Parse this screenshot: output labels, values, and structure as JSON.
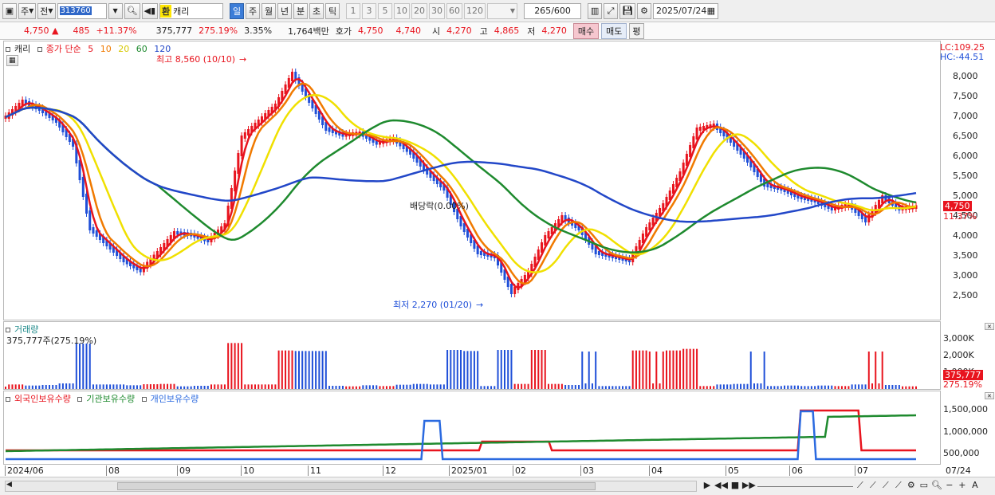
{
  "toolbar": {
    "type": "주",
    "market": "전",
    "code": "313760",
    "tag": "환",
    "name": "캐리",
    "periods": [
      "일",
      "주",
      "월",
      "년",
      "분",
      "초",
      "틱"
    ],
    "active_period": "일",
    "intervals": [
      "1",
      "3",
      "5",
      "10",
      "20",
      "30",
      "60",
      "120"
    ],
    "count": "265",
    "count_total": "/600",
    "date": "2025/07/24"
  },
  "quote": {
    "price": "4,750",
    "arrow": "▲",
    "change": "485",
    "change_pct": "+11.37%",
    "volume": "375,777",
    "volume_ratio": "275.19%",
    "turnover": "3.35%",
    "amount": "1,764백만",
    "ask_label": "호가",
    "ask1": "4,750",
    "ask2": "4,740",
    "open_label": "시",
    "open": "4,270",
    "high_label": "고",
    "high": "4,865",
    "low_label": "저",
    "low": "4,270",
    "buy": "매수",
    "sell": "매도",
    "eval": "평"
  },
  "price_panel": {
    "name": "캐리",
    "ma_label": "종가 단순",
    "ma_periods": [
      "5",
      "10",
      "20",
      "60",
      "120"
    ],
    "ma_colors": [
      "#e8141e",
      "#f07a00",
      "#f0e000",
      "#1e8a2e",
      "#2247c8"
    ],
    "lc": "LC:109.25",
    "hc": "HC:-44.51",
    "y_ticks": [
      "8,000",
      "7,500",
      "7,000",
      "6,500",
      "6,000",
      "5,500",
      "5,000",
      "4,500",
      "4,000",
      "3,500",
      "3,000",
      "2,500"
    ],
    "cur_price": "4,750",
    "cur_pct": "11.37%",
    "high_note": "최고 8,560 (10/10)",
    "low_note": "최저 2,270 (01/20)",
    "div_note": "배당락(0.00%)"
  },
  "volume_panel": {
    "title": "거래량",
    "value": "375,777주(275.19%)",
    "y_ticks": [
      "3,000K",
      "2,000K",
      "1,000K"
    ],
    "cur_vol": "375,777",
    "cur_pct": "275.19%"
  },
  "holdings_panel": {
    "series": [
      "외국인보유수량",
      "기관보유수량",
      "개인보유수량"
    ],
    "colors": [
      "#e8141e",
      "#1e8a2e",
      "#2b6ae0"
    ],
    "y_ticks": [
      "1,500,000",
      "1,000,000",
      "500,000"
    ]
  },
  "x_axis": [
    "2024/06",
    "08",
    "09",
    "10",
    "11",
    "12",
    "2025/01",
    "02",
    "03",
    "04",
    "05",
    "06",
    "07"
  ],
  "x_last": "07/24",
  "chart_data": {
    "type": "line",
    "title": "캐리",
    "close_approx": [
      7000,
      7400,
      7200,
      6900,
      6300,
      4200,
      3800,
      3400,
      3150,
      3600,
      4100,
      4050,
      3900,
      4300,
      6500,
      6900,
      7300,
      8100,
      7400,
      6700,
      6550,
      6600,
      6350,
      6450,
      6100,
      5600,
      5200,
      4300,
      3600,
      3500,
      2600,
      3100,
      4000,
      4500,
      4200,
      3600,
      3500,
      3400,
      4200,
      4800,
      5600,
      6700,
      6800,
      6400,
      5900,
      5300,
      5200,
      5000,
      4900,
      4700,
      4800,
      4400,
      5000,
      4700,
      4750
    ],
    "ma_periods": [
      5,
      10,
      20,
      60,
      120
    ],
    "ylim": [
      2270,
      8560
    ],
    "annotations": {
      "high": "8,560 (10/10)",
      "low": "2,270 (01/20)"
    }
  }
}
